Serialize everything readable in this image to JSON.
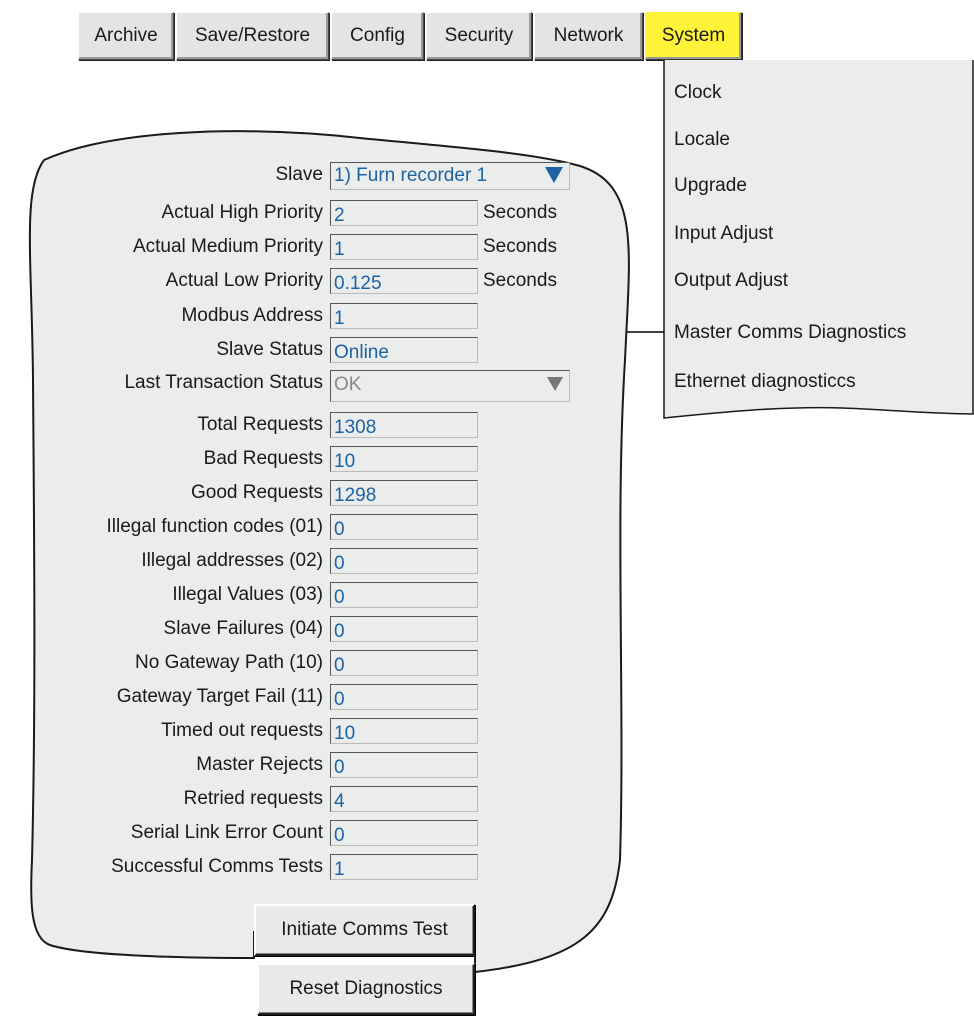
{
  "tabs": [
    {
      "label": "Archive"
    },
    {
      "label": "Save/Restore"
    },
    {
      "label": "Config"
    },
    {
      "label": "Security"
    },
    {
      "label": "Network"
    },
    {
      "label": "System",
      "active": true
    }
  ],
  "system_menu": {
    "items": [
      {
        "label": "Clock"
      },
      {
        "label": "Locale"
      },
      {
        "label": "Upgrade"
      },
      {
        "label": "Input Adjust"
      },
      {
        "label": "Output Adjust"
      },
      {
        "label": "Master Comms Diagnostics"
      },
      {
        "label": "Ethernet diagnosticcs"
      }
    ]
  },
  "form": {
    "slave": {
      "label": "Slave",
      "value": "1) Furn recorder 1"
    },
    "actual_high": {
      "label": "Actual High Priority",
      "value": "2",
      "unit": "Seconds"
    },
    "actual_medium": {
      "label": "Actual Medium Priority",
      "value": "1",
      "unit": "Seconds"
    },
    "actual_low": {
      "label": "Actual Low Priority",
      "value": "0.125",
      "unit": "Seconds"
    },
    "modbus_address": {
      "label": "Modbus Address",
      "value": "1"
    },
    "slave_status": {
      "label": "Slave Status",
      "value": "Online"
    },
    "last_transaction": {
      "label": "Last Transaction Status",
      "value": "OK"
    },
    "total_requests": {
      "label": "Total Requests",
      "value": "1308"
    },
    "bad_requests": {
      "label": "Bad Requests",
      "value": "10"
    },
    "good_requests": {
      "label": "Good Requests",
      "value": "1298"
    },
    "illegal_function": {
      "label": "Illegal function codes (01)",
      "value": "0"
    },
    "illegal_addresses": {
      "label": "Illegal addresses (02)",
      "value": "0"
    },
    "illegal_values": {
      "label": "Illegal Values (03)",
      "value": "0"
    },
    "slave_failures": {
      "label": "Slave Failures (04)",
      "value": "0"
    },
    "no_gateway": {
      "label": "No Gateway Path (10)",
      "value": "0"
    },
    "gateway_target": {
      "label": "Gateway Target Fail (11)",
      "value": "0"
    },
    "timed_out": {
      "label": "Timed out requests",
      "value": "10"
    },
    "master_rejects": {
      "label": "Master Rejects",
      "value": "0"
    },
    "retried": {
      "label": "Retried requests",
      "value": "4"
    },
    "serial_link": {
      "label": "Serial Link Error Count",
      "value": "0"
    },
    "successful_tests": {
      "label": "Successful Comms Tests",
      "value": "1"
    }
  },
  "buttons": {
    "initiate": "Initiate Comms Test",
    "reset": "Reset Diagnostics"
  },
  "colors": {
    "value_text": "#1c63a3",
    "panel_bg": "#ebecec",
    "active_tab": "#fff33a",
    "dropdown_arrow": "#1c63a3"
  }
}
